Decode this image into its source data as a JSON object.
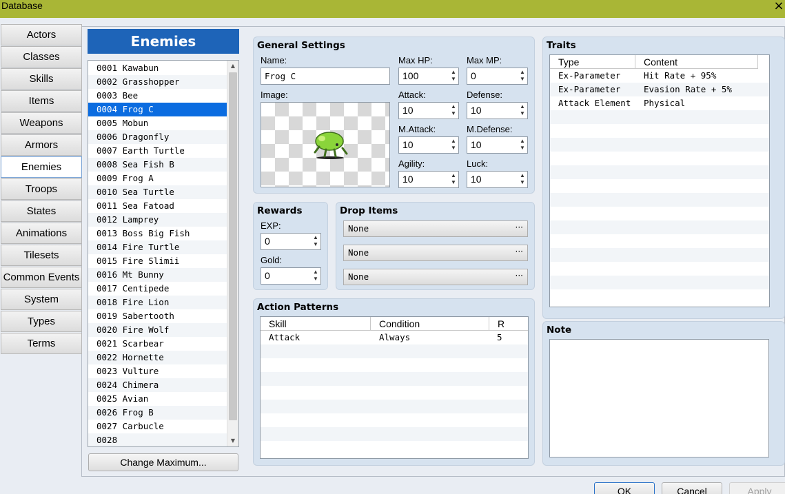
{
  "window": {
    "title": "Database",
    "close_icon": "×"
  },
  "categories": [
    "Actors",
    "Classes",
    "Skills",
    "Items",
    "Weapons",
    "Armors",
    "Enemies",
    "Troops",
    "States",
    "Animations",
    "Tilesets",
    "Common Events",
    "System",
    "Types",
    "Terms"
  ],
  "active_category": "Enemies",
  "list": {
    "header": "Enemies",
    "items": [
      "0001 Kawabun",
      "0002 Grasshopper",
      "0003 Bee",
      "0004 Frog C",
      "0005 Mobun",
      "0006 Dragonfly",
      "0007 Earth Turtle",
      "0008 Sea Fish B",
      "0009 Frog A",
      "0010 Sea Turtle",
      "0011 Sea Fatoad",
      "0012 Lamprey",
      "0013 Boss Big Fish",
      "0014 Fire Turtle",
      "0015 Fire Slimii",
      "0016 Mt Bunny",
      "0017 Centipede",
      "0018 Fire Lion",
      "0019 Sabertooth",
      "0020 Fire Wolf",
      "0021 Scarbear",
      "0022 Hornette",
      "0023 Vulture",
      "0024 Chimera",
      "0025 Avian",
      "0026 Frog B",
      "0027 Carbucle",
      "0028"
    ],
    "selected": "0004 Frog C",
    "change_max_button": "Change Maximum..."
  },
  "general": {
    "title": "General Settings",
    "name_label": "Name:",
    "name_value": "Frog C",
    "image_label": "Image:",
    "maxhp_label": "Max HP:",
    "maxhp_value": "100",
    "maxmp_label": "Max MP:",
    "maxmp_value": "0",
    "attack_label": "Attack:",
    "attack_value": "10",
    "defense_label": "Defense:",
    "defense_value": "10",
    "mattack_label": "M.Attack:",
    "mattack_value": "10",
    "mdefense_label": "M.Defense:",
    "mdefense_value": "10",
    "agility_label": "Agility:",
    "agility_value": "10",
    "luck_label": "Luck:",
    "luck_value": "10"
  },
  "rewards": {
    "title": "Rewards",
    "exp_label": "EXP:",
    "exp_value": "0",
    "gold_label": "Gold:",
    "gold_value": "0"
  },
  "drops": {
    "title": "Drop Items",
    "items": [
      "None",
      "None",
      "None"
    ],
    "more_label": "···"
  },
  "actions": {
    "title": "Action Patterns",
    "headers": [
      "Skill",
      "Condition",
      "R"
    ],
    "rows": [
      {
        "skill": "Attack",
        "condition": "Always",
        "r": "5"
      }
    ]
  },
  "traits": {
    "title": "Traits",
    "headers": [
      "Type",
      "Content"
    ],
    "rows": [
      {
        "type": "Ex-Parameter",
        "content": "Hit Rate + 95%"
      },
      {
        "type": "Ex-Parameter",
        "content": "Evasion Rate + 5%"
      },
      {
        "type": "Attack Element",
        "content": "Physical"
      }
    ]
  },
  "note": {
    "title": "Note",
    "value": ""
  },
  "footer": {
    "ok": "OK",
    "cancel": "Cancel",
    "apply": "Apply"
  }
}
